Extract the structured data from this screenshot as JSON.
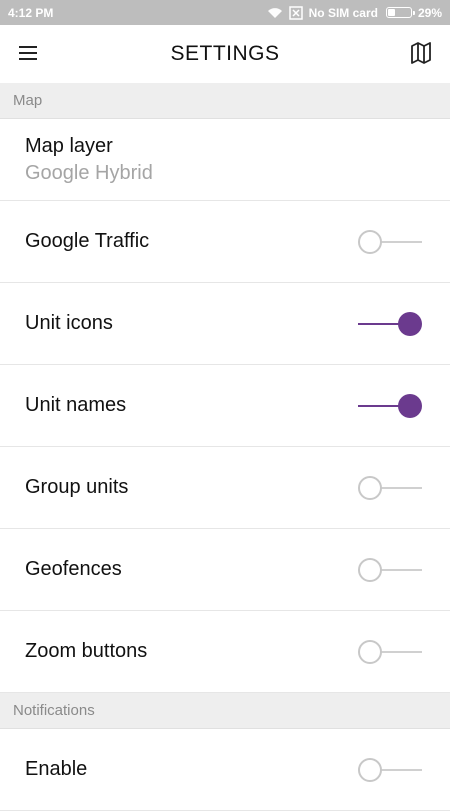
{
  "status_bar": {
    "time": "4:12 PM",
    "sim": "No SIM card",
    "battery": "29%",
    "battery_level": 0.29
  },
  "app_bar": {
    "title": "SETTINGS"
  },
  "sections": {
    "map": {
      "header": "Map",
      "map_layer": {
        "label": "Map layer",
        "value": "Google Hybrid"
      },
      "google_traffic": {
        "label": "Google Traffic",
        "on": false
      },
      "unit_icons": {
        "label": "Unit icons",
        "on": true
      },
      "unit_names": {
        "label": "Unit names",
        "on": true
      },
      "group_units": {
        "label": "Group units",
        "on": false
      },
      "geofences": {
        "label": "Geofences",
        "on": false
      },
      "zoom_buttons": {
        "label": "Zoom buttons",
        "on": false
      }
    },
    "notifications": {
      "header": "Notifications",
      "enable": {
        "label": "Enable",
        "on": false
      }
    }
  },
  "colors": {
    "accent": "#6b3a8e",
    "status_bar": "#bdbdbd",
    "section_header_bg": "#eeeeee"
  },
  "icons": {
    "menu": "hamburger-icon",
    "map": "map-icon",
    "wifi": "wifi-icon",
    "no_sim": "no-sim-icon",
    "battery": "battery-icon"
  }
}
